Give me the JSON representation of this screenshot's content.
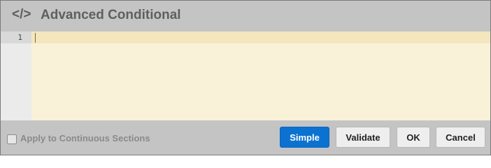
{
  "header": {
    "icon_glyph": "</>",
    "icon_name": "code-icon",
    "title": "Advanced Conditional"
  },
  "editor": {
    "line_numbers": [
      "1"
    ],
    "content": ""
  },
  "footer": {
    "checkbox_label": "Apply to Continuous Sections",
    "checkbox_checked": false,
    "buttons": {
      "simple": "Simple",
      "validate": "Validate",
      "ok": "OK",
      "cancel": "Cancel"
    }
  },
  "colors": {
    "primary_button": "#0b72d1",
    "editor_background": "#faf1d9",
    "chrome_background": "#c4c4c4"
  }
}
